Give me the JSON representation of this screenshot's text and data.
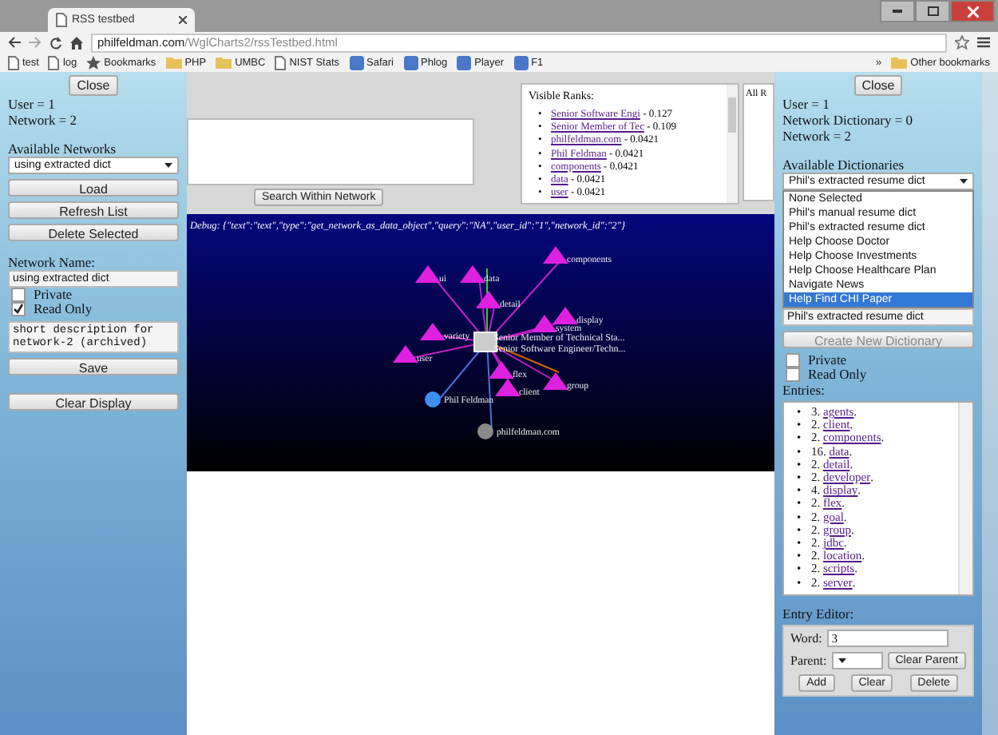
{
  "browser": {
    "tab_title": "RSS testbed",
    "url_host": "philfeldman.com",
    "url_path": "/WglCharts2/rssTestbed.html",
    "bookmarks": [
      {
        "label": "test",
        "kind": "page"
      },
      {
        "label": "log",
        "kind": "page"
      },
      {
        "label": "Bookmarks",
        "kind": "star"
      },
      {
        "label": "PHP",
        "kind": "folder"
      },
      {
        "label": "UMBC",
        "kind": "folder"
      },
      {
        "label": "NIST Stats",
        "kind": "page"
      },
      {
        "label": "Safari",
        "kind": "site"
      },
      {
        "label": "Phlog",
        "kind": "site"
      },
      {
        "label": "Player",
        "kind": "site"
      },
      {
        "label": "F1",
        "kind": "site"
      }
    ],
    "more": "»",
    "other_bookmarks": "Other bookmarks"
  },
  "left_panel": {
    "close": "Close",
    "user": "User = 1",
    "network": "Network = 2",
    "networks_label": "Available Networks",
    "networks_value": "using extracted dict",
    "buttons": [
      "Load",
      "Refresh List",
      "Delete Selected"
    ],
    "name_label": "Network Name:",
    "name_value": "using extracted dict",
    "checkboxes": [
      {
        "label": "Private",
        "checked": false
      },
      {
        "label": "Read Only",
        "checked": true
      }
    ],
    "description": "short description for network-2 (archived)",
    "save": "Save",
    "clear_display": "Clear Display"
  },
  "main": {
    "bullet": "•",
    "search_button": "Search Within Network",
    "ranks_title": "Visible Ranks:",
    "ranks": [
      {
        "name": "Senior Software Engi",
        "score": " - 0.127"
      },
      {
        "name": "Senior Member of Tec",
        "score": " - 0.109"
      },
      {
        "name": "philfeldman.com",
        "score": " - 0.0421"
      },
      {
        "name": "Phil Feldman",
        "score": " - 0.0421"
      },
      {
        "name": "components",
        "score": " - 0.0421"
      },
      {
        "name": "data",
        "score": " - 0.0421"
      },
      {
        "name": "user",
        "score": " - 0.0421"
      }
    ],
    "all_ranks_title": "All R",
    "debug": "Debug: {\"text\":\"text\",\"type\":\"get_network_as_data_object\",\"query\":\"NA\",\"user_id\":\"1\",\"network_id\":\"2\"}",
    "graph": {
      "center_labels": [
        "Senior Member of Technical Sta...",
        "Senior Software Engineer/Techn..."
      ],
      "nodes": [
        {
          "label": "components",
          "kind": "cone"
        },
        {
          "label": "ui",
          "kind": "cone"
        },
        {
          "label": "data",
          "kind": "cone"
        },
        {
          "label": "detail",
          "kind": "cone"
        },
        {
          "label": "display",
          "kind": "cone"
        },
        {
          "label": "system",
          "kind": "cone"
        },
        {
          "label": "variety",
          "kind": "cone"
        },
        {
          "label": "user",
          "kind": "cone"
        },
        {
          "label": "flex",
          "kind": "cone"
        },
        {
          "label": "group",
          "kind": "cone"
        },
        {
          "label": "client",
          "kind": "cone"
        },
        {
          "label": "Phil Feldman",
          "kind": "sphere",
          "color": "#3d8ef0"
        },
        {
          "label": "philfeldman.com",
          "kind": "sphere",
          "color": "#8a8a8a"
        }
      ]
    }
  },
  "right_panel": {
    "close": "Close",
    "user": "User = 1",
    "dictionary": "Network Dictionary = 0",
    "network": "Network = 2",
    "dict_label": "Available Dictionaries",
    "dict_value": "Phil's extracted resume dict",
    "options": [
      {
        "label": "None Selected",
        "selected": false
      },
      {
        "label": "Phil's manual resume dict",
        "selected": false
      },
      {
        "label": "Phil's extracted resume dict",
        "selected": false
      },
      {
        "label": "Help Choose Doctor",
        "selected": false
      },
      {
        "label": "Help Choose Investments",
        "selected": false
      },
      {
        "label": "Help Choose Healthcare Plan",
        "selected": false
      },
      {
        "label": "Navigate News",
        "selected": false
      },
      {
        "label": "Help Find CHI Paper",
        "selected": true
      }
    ],
    "dict_name": "Phil's extracted resume dict",
    "create": {
      "label": "Create New Dictionary",
      "disabled": true
    },
    "checkboxes": [
      {
        "label": "Private",
        "checked": false
      },
      {
        "label": "Read Only",
        "checked": false
      }
    ],
    "entries_label": "Entries:",
    "bullet": "•",
    "entries": [
      {
        "count": "3. ",
        "word": "agents",
        "end": "."
      },
      {
        "count": "2. ",
        "word": "client",
        "end": "."
      },
      {
        "count": "2. ",
        "word": "components",
        "end": "."
      },
      {
        "count": "16. ",
        "word": "data",
        "end": "."
      },
      {
        "count": "2. ",
        "word": "detail",
        "end": "."
      },
      {
        "count": "2. ",
        "word": "developer",
        "end": "."
      },
      {
        "count": "4. ",
        "word": "display",
        "end": "."
      },
      {
        "count": "2. ",
        "word": "flex",
        "end": "."
      },
      {
        "count": "2. ",
        "word": "goal",
        "end": "."
      },
      {
        "count": "2. ",
        "word": "group",
        "end": "."
      },
      {
        "count": "2. ",
        "word": "jdbc",
        "end": "."
      },
      {
        "count": "2. ",
        "word": "location",
        "end": "."
      },
      {
        "count": "2. ",
        "word": "scripts",
        "end": "."
      },
      {
        "count": "2. ",
        "word": "server",
        "end": "."
      }
    ],
    "editor": {
      "label": "Entry Editor:",
      "word_label": "Word:",
      "word_value": "3",
      "parent_label": "Parent:",
      "clear_parent": "Clear Parent",
      "buttons": [
        "Add",
        "Clear",
        "Delete"
      ]
    }
  }
}
